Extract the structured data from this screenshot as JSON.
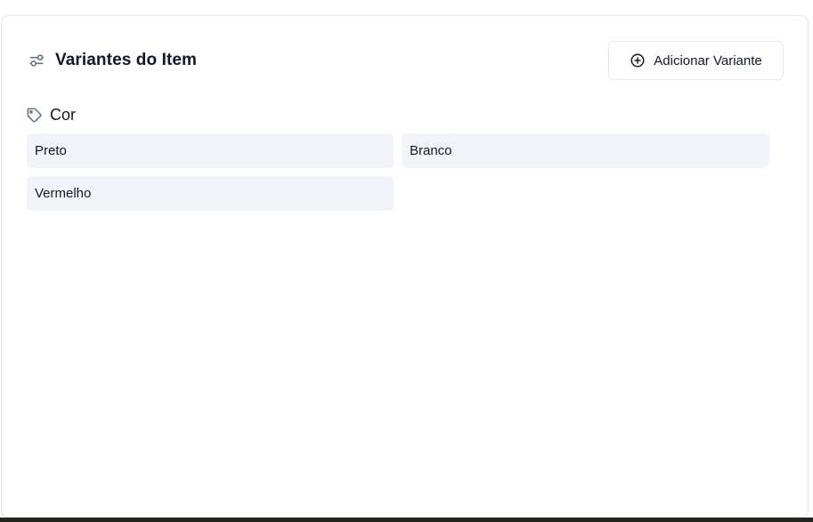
{
  "card": {
    "title": "Variantes do Item",
    "title_icon": "sliders-icon",
    "add_button": {
      "label": "Adicionar Variante",
      "icon": "plus-circle-icon"
    }
  },
  "groups": [
    {
      "name": "Cor",
      "icon": "tag-icon",
      "options": [
        "Preto",
        "Branco",
        "Vermelho"
      ]
    }
  ],
  "colors": {
    "chip_background": "#f1f4f9",
    "border": "#e5e7eb",
    "muted_icon": "#64748b",
    "text": "#0f172a"
  }
}
